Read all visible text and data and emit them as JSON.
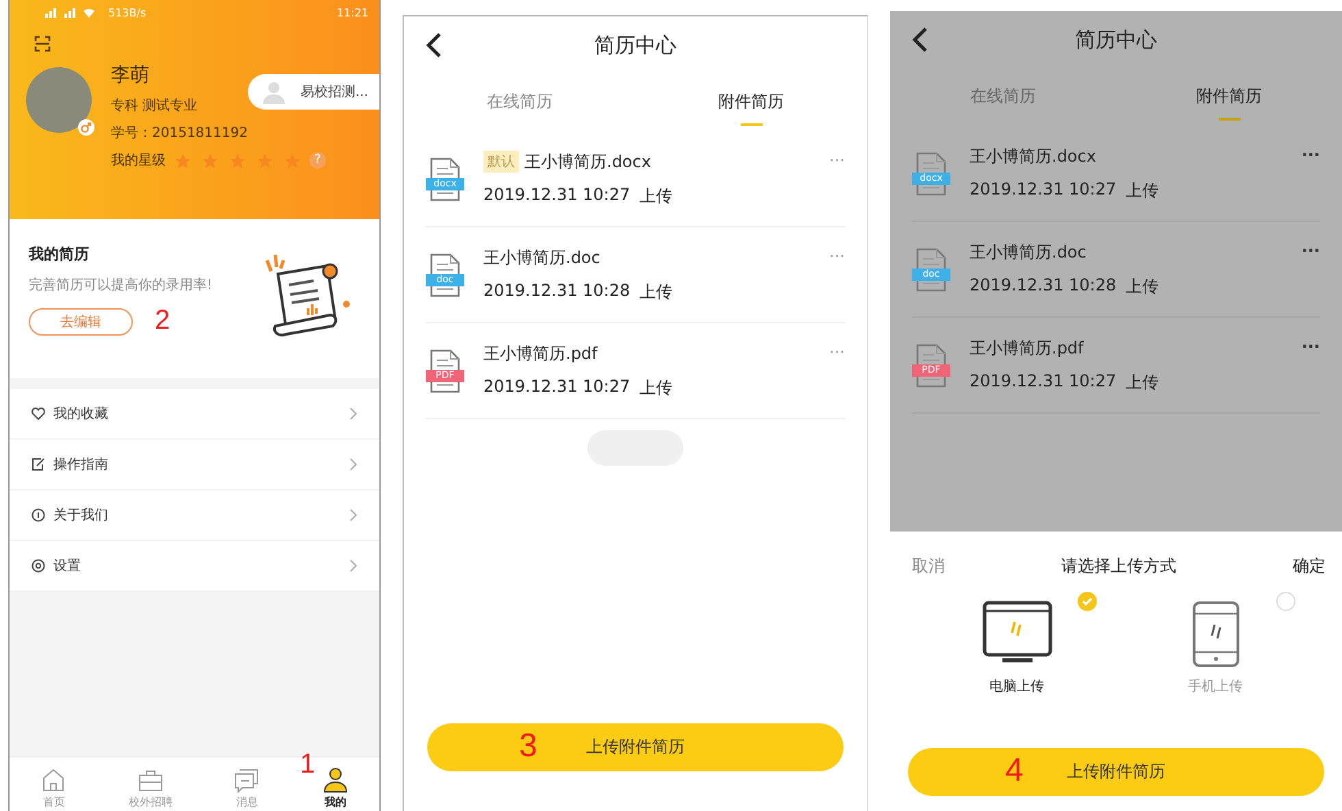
{
  "profile_screen": {
    "status_bar": {
      "speed": "513B/s",
      "time": "11:21"
    },
    "user": {
      "name": "李萌",
      "major": "专科 测试专业",
      "student_id": "学号：20151811192",
      "stars_label": "我的星级",
      "stars": 5,
      "help": "?"
    },
    "school_button": "易校招测...",
    "resume_card": {
      "title": "我的简历",
      "subtitle": "完善简历可以提高你的录用率!",
      "button": "去编辑",
      "annotation": "2"
    },
    "menu": [
      {
        "label": "我的收藏",
        "kind": "heart"
      },
      {
        "label": "操作指南",
        "kind": "guide"
      },
      {
        "label": "关于我们",
        "kind": "info"
      },
      {
        "label": "设置",
        "kind": "settings"
      }
    ],
    "tab_bar": [
      {
        "label": "首页",
        "kind": "home",
        "selected": false
      },
      {
        "label": "校外招聘",
        "kind": "briefcase",
        "selected": false
      },
      {
        "label": "消息",
        "kind": "chat",
        "selected": false
      },
      {
        "label": "我的",
        "kind": "person",
        "selected": true
      }
    ],
    "annotation": "1"
  },
  "resume_center_screen": {
    "title": "简历中心",
    "tabs": [
      {
        "label": "在线简历",
        "selected": false
      },
      {
        "label": "附件简历",
        "selected": true
      }
    ],
    "files": [
      {
        "badge": "默认",
        "name": "王小博简历.docx",
        "date": "2019.12.31 10:27",
        "status": "上传",
        "icon_label": "docx",
        "kind": "word",
        "more": "···"
      },
      {
        "name": "王小博简历.doc",
        "date": "2019.12.31 10:28",
        "status": "上传",
        "icon_label": "doc",
        "kind": "word",
        "more": "···"
      },
      {
        "name": "王小博简历.pdf",
        "date": "2019.12.31 10:27",
        "status": "上传",
        "icon_label": "PDF",
        "kind": "pdf",
        "more": "···"
      }
    ],
    "button": "上传附件简历",
    "annotation": "3"
  },
  "upload_dialog_screen": {
    "title": "简历中心",
    "tabs": [
      {
        "label": "在线简历",
        "selected": false
      },
      {
        "label": "附件简历",
        "selected": true
      }
    ],
    "files": [
      {
        "name": "王小博简历.docx",
        "date": "2019.12.31 10:27",
        "status": "上传",
        "icon_label": "docx",
        "kind": "word",
        "more": "···"
      },
      {
        "name": "王小博简历.doc",
        "date": "2019.12.31 10:28",
        "status": "上传",
        "icon_label": "doc",
        "kind": "word",
        "more": "···"
      },
      {
        "name": "王小博简历.pdf",
        "date": "2019.12.31 10:27",
        "status": "上传",
        "icon_label": "PDF",
        "kind": "pdf",
        "more": "···"
      }
    ],
    "sheet": {
      "cancel": "取消",
      "title": "请选择上传方式",
      "confirm": "确定",
      "options": [
        {
          "label": "电脑上传",
          "kind": "computer",
          "selected": true
        },
        {
          "label": "手机上传",
          "kind": "phone",
          "selected": false
        }
      ]
    },
    "button": "上传附件简历",
    "annotation": "4"
  }
}
